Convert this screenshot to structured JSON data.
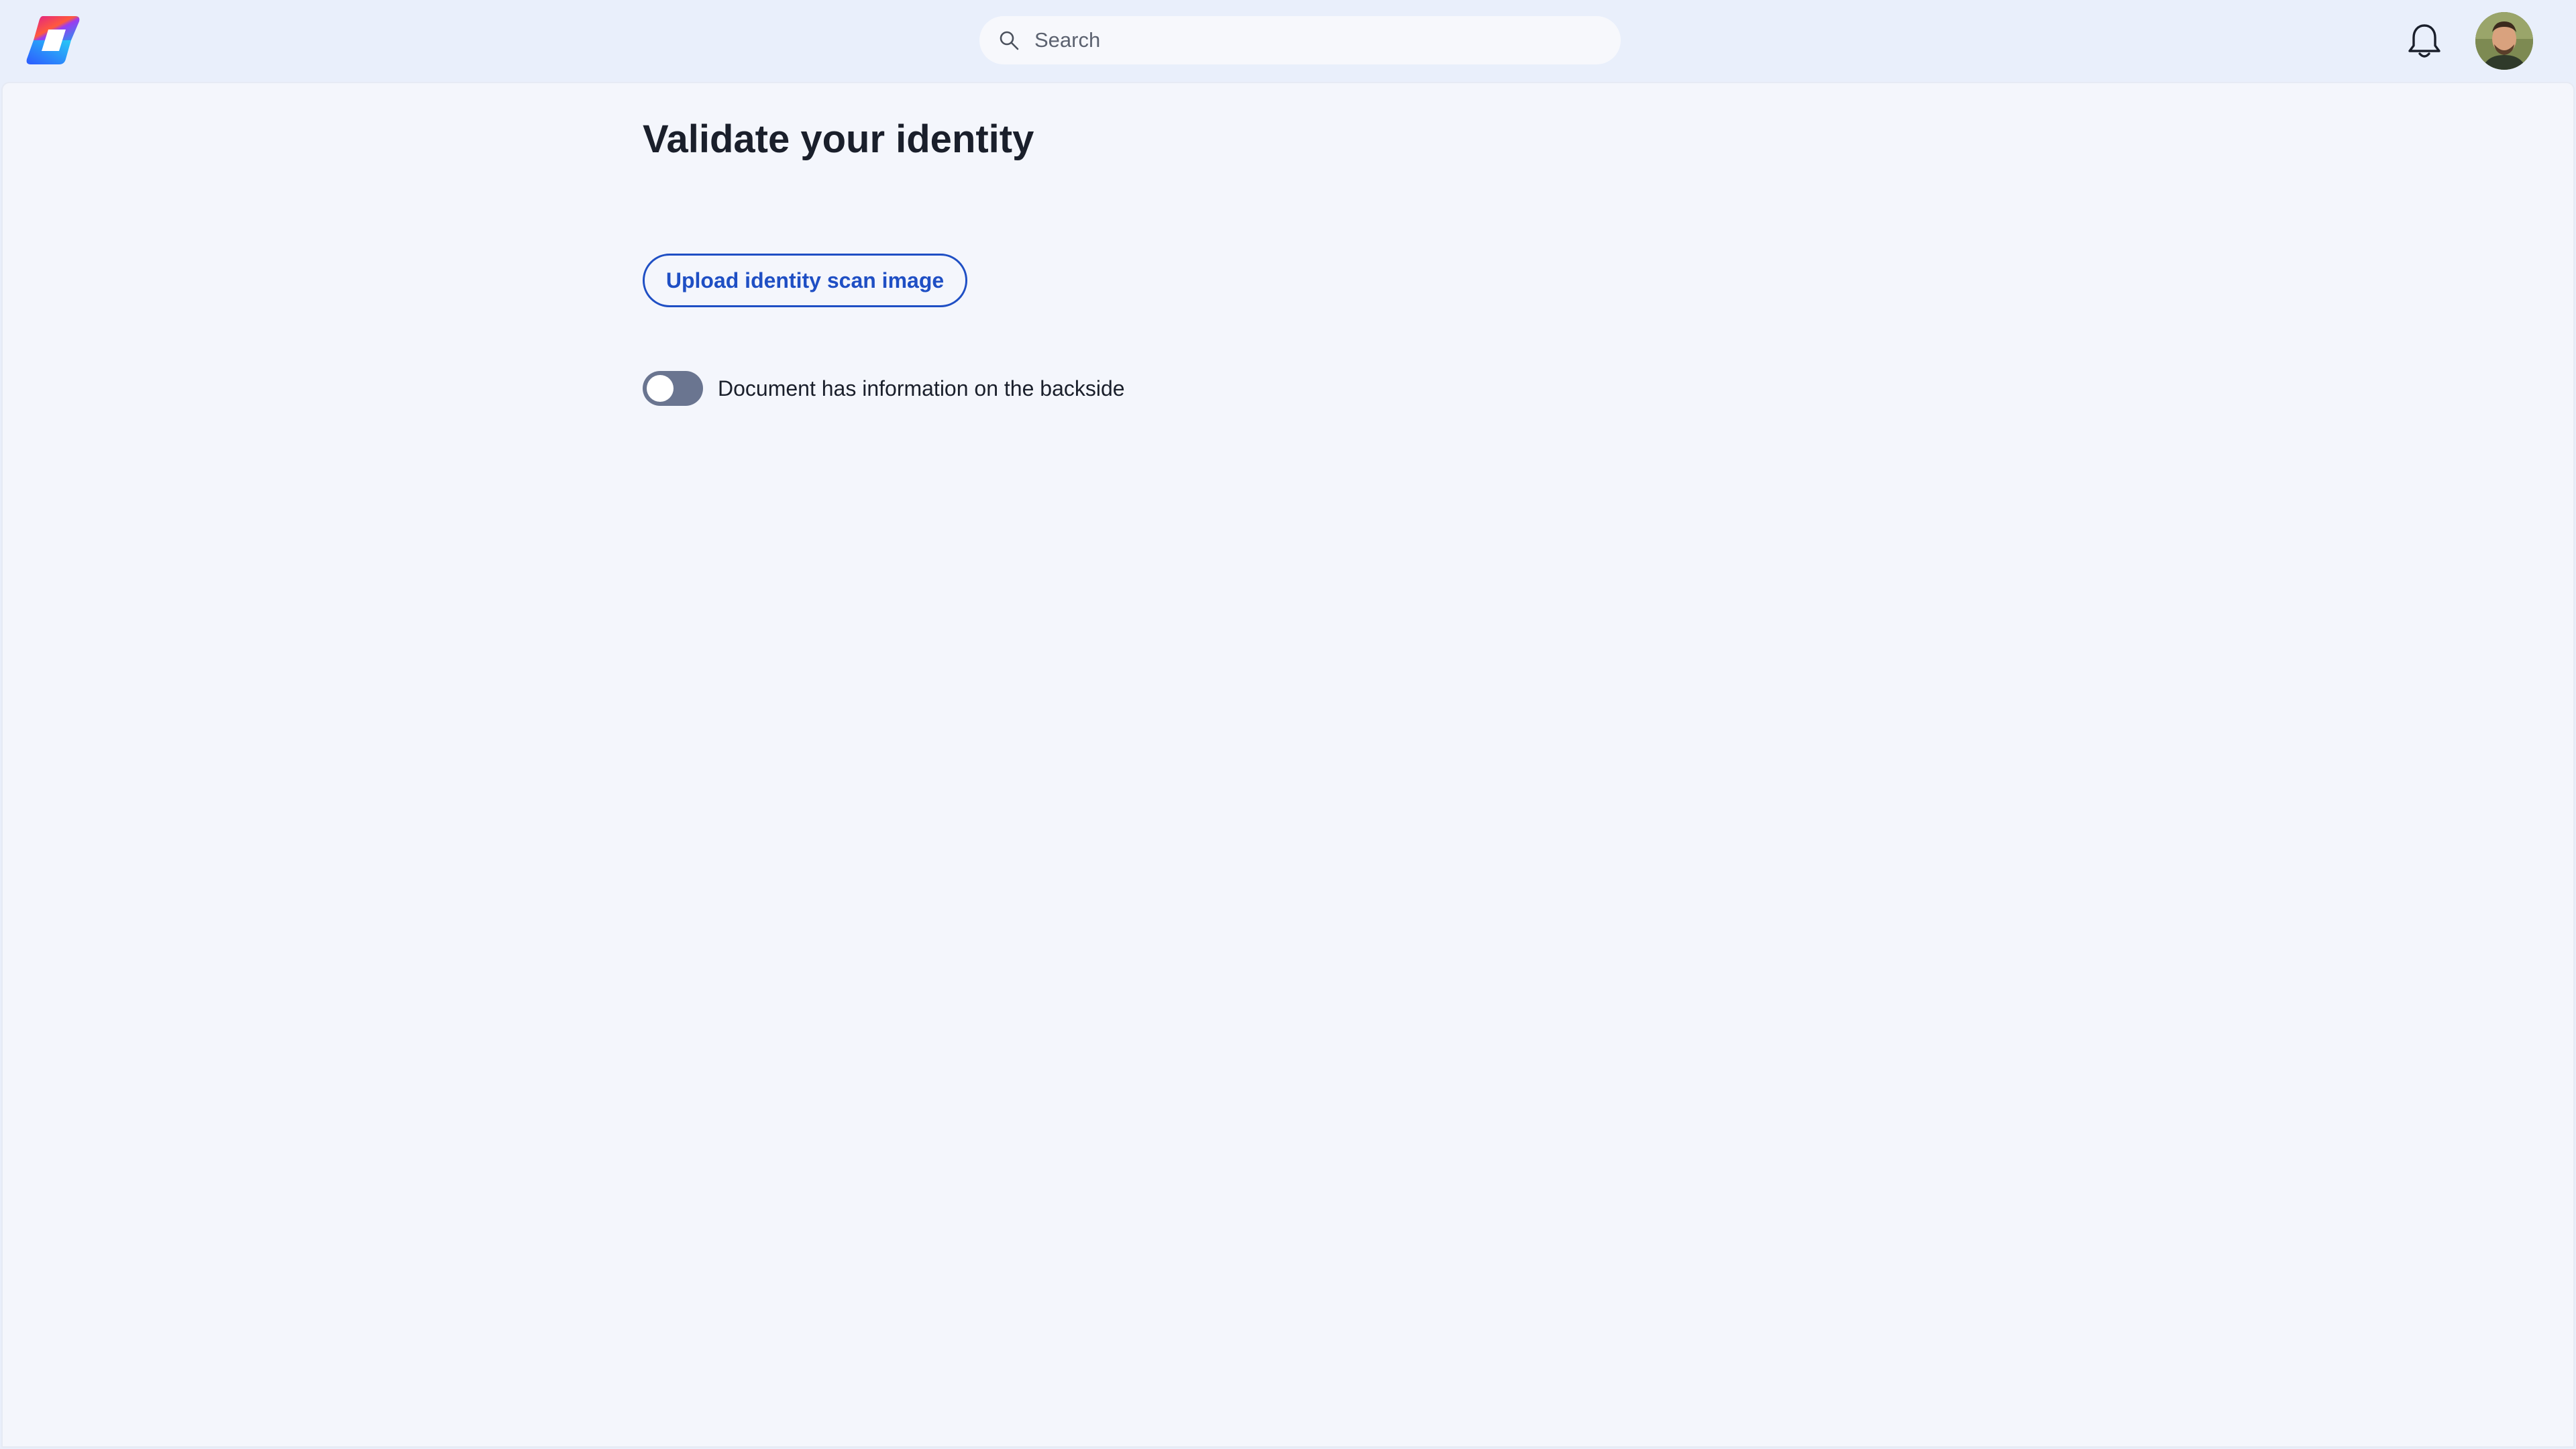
{
  "header": {
    "logo_icon": "app-logo-icon",
    "search": {
      "placeholder": "Search",
      "value": "",
      "icon": "search-icon"
    },
    "notifications_icon": "bell-icon",
    "avatar_icon": "user-avatar"
  },
  "main": {
    "title": "Validate your identity",
    "upload_button_label": "Upload identity scan image",
    "backside_toggle": {
      "label": "Document has information on the backside",
      "checked": false
    }
  },
  "colors": {
    "header_bg": "#e9effb",
    "content_bg": "#f4f6fc",
    "accent": "#1f4fc4",
    "toggle_off": "#6a7590",
    "text": "#1a1f2b"
  }
}
